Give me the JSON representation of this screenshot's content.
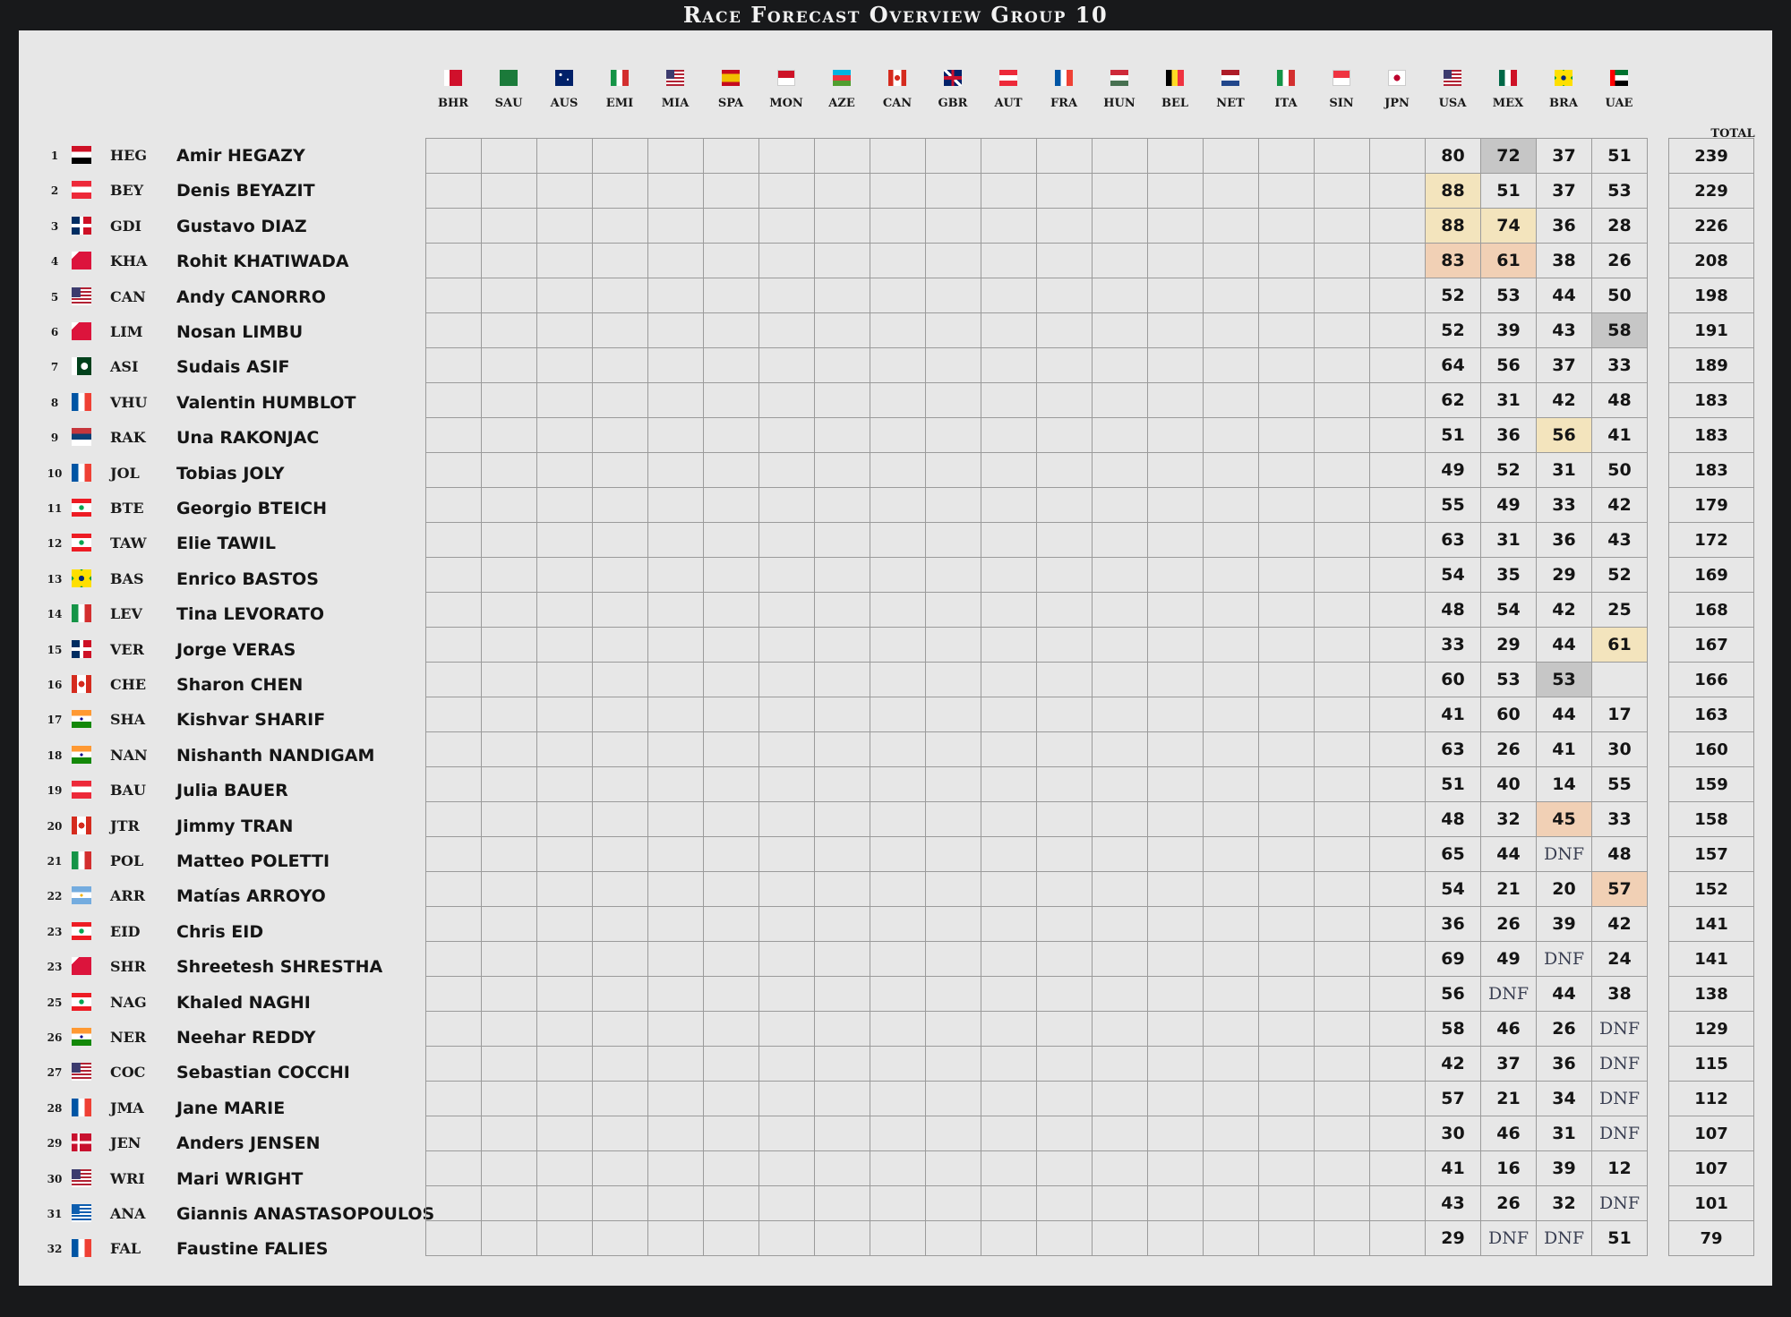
{
  "title": "Race Forecast Overview Group 10",
  "races": [
    {
      "code": "BHR",
      "flag": "bhr"
    },
    {
      "code": "SAU",
      "flag": "sau"
    },
    {
      "code": "AUS",
      "flag": "aus"
    },
    {
      "code": "EMI",
      "flag": "ita"
    },
    {
      "code": "MIA",
      "flag": "usa"
    },
    {
      "code": "SPA",
      "flag": "spa"
    },
    {
      "code": "MON",
      "flag": "mon"
    },
    {
      "code": "AZE",
      "flag": "aze"
    },
    {
      "code": "CAN",
      "flag": "can"
    },
    {
      "code": "GBR",
      "flag": "gbr"
    },
    {
      "code": "AUT",
      "flag": "aut"
    },
    {
      "code": "FRA",
      "flag": "fra"
    },
    {
      "code": "HUN",
      "flag": "hun"
    },
    {
      "code": "BEL",
      "flag": "bel"
    },
    {
      "code": "NET",
      "flag": "net"
    },
    {
      "code": "ITA",
      "flag": "ita"
    },
    {
      "code": "SIN",
      "flag": "sin"
    },
    {
      "code": "JPN",
      "flag": "jpn"
    },
    {
      "code": "USA",
      "flag": "usa"
    },
    {
      "code": "MEX",
      "flag": "mex"
    },
    {
      "code": "BRA",
      "flag": "bra"
    },
    {
      "code": "UAE",
      "flag": "uae"
    }
  ],
  "total_header": "TOTAL",
  "highlight_colors": {
    "gray": "#c6c6c6",
    "yellow": "#f3e4bd",
    "peach": "#f1d0b5"
  },
  "players": [
    {
      "rank": "1",
      "flag": "egy",
      "code": "HEG",
      "name": "Amir HEGAZY",
      "scores": {
        "USA": "80",
        "MEX": "72",
        "BRA": "37",
        "UAE": "51"
      },
      "highlights": {
        "MEX": "gray"
      },
      "total": "239"
    },
    {
      "rank": "2",
      "flag": "aut",
      "code": "BEY",
      "name": "Denis BEYAZIT",
      "scores": {
        "USA": "88",
        "MEX": "51",
        "BRA": "37",
        "UAE": "53"
      },
      "highlights": {
        "USA": "yellow"
      },
      "total": "229"
    },
    {
      "rank": "3",
      "flag": "dom",
      "code": "GDI",
      "name": "Gustavo DIAZ",
      "scores": {
        "USA": "88",
        "MEX": "74",
        "BRA": "36",
        "UAE": "28"
      },
      "highlights": {
        "USA": "yellow",
        "MEX": "yellow"
      },
      "total": "226"
    },
    {
      "rank": "4",
      "flag": "npl",
      "code": "KHA",
      "name": "Rohit KHATIWADA",
      "scores": {
        "USA": "83",
        "MEX": "61",
        "BRA": "38",
        "UAE": "26"
      },
      "highlights": {
        "USA": "peach",
        "MEX": "peach"
      },
      "total": "208"
    },
    {
      "rank": "5",
      "flag": "usa",
      "code": "CAN",
      "name": "Andy CANORRO",
      "scores": {
        "USA": "52",
        "MEX": "53",
        "BRA": "44",
        "UAE": "50"
      },
      "highlights": {},
      "total": "198"
    },
    {
      "rank": "6",
      "flag": "npl",
      "code": "LIM",
      "name": "Nosan LIMBU",
      "scores": {
        "USA": "52",
        "MEX": "39",
        "BRA": "43",
        "UAE": "58"
      },
      "highlights": {
        "UAE": "gray"
      },
      "total": "191"
    },
    {
      "rank": "7",
      "flag": "pak",
      "code": "ASI",
      "name": "Sudais ASIF",
      "scores": {
        "USA": "64",
        "MEX": "56",
        "BRA": "37",
        "UAE": "33"
      },
      "highlights": {},
      "total": "189"
    },
    {
      "rank": "8",
      "flag": "fra",
      "code": "VHU",
      "name": "Valentin HUMBLOT",
      "scores": {
        "USA": "62",
        "MEX": "31",
        "BRA": "42",
        "UAE": "48"
      },
      "highlights": {},
      "total": "183"
    },
    {
      "rank": "9",
      "flag": "srb",
      "code": "RAK",
      "name": "Una RAKONJAC",
      "scores": {
        "USA": "51",
        "MEX": "36",
        "BRA": "56",
        "UAE": "41"
      },
      "highlights": {
        "BRA": "yellow"
      },
      "total": "183"
    },
    {
      "rank": "10",
      "flag": "fra",
      "code": "JOL",
      "name": "Tobias JOLY",
      "scores": {
        "USA": "49",
        "MEX": "52",
        "BRA": "31",
        "UAE": "50"
      },
      "highlights": {},
      "total": "183"
    },
    {
      "rank": "11",
      "flag": "lbn",
      "code": "BTE",
      "name": "Georgio BTEICH",
      "scores": {
        "USA": "55",
        "MEX": "49",
        "BRA": "33",
        "UAE": "42"
      },
      "highlights": {},
      "total": "179"
    },
    {
      "rank": "12",
      "flag": "lbn",
      "code": "TAW",
      "name": "Elie TAWIL",
      "scores": {
        "USA": "63",
        "MEX": "31",
        "BRA": "36",
        "UAE": "43"
      },
      "highlights": {},
      "total": "172"
    },
    {
      "rank": "13",
      "flag": "bra",
      "code": "BAS",
      "name": "Enrico BASTOS",
      "scores": {
        "USA": "54",
        "MEX": "35",
        "BRA": "29",
        "UAE": "52"
      },
      "highlights": {},
      "total": "169"
    },
    {
      "rank": "14",
      "flag": "ita",
      "code": "LEV",
      "name": "Tina LEVORATO",
      "scores": {
        "USA": "48",
        "MEX": "54",
        "BRA": "42",
        "UAE": "25"
      },
      "highlights": {},
      "total": "168"
    },
    {
      "rank": "15",
      "flag": "dom",
      "code": "VER",
      "name": "Jorge VERAS",
      "scores": {
        "USA": "33",
        "MEX": "29",
        "BRA": "44",
        "UAE": "61"
      },
      "highlights": {
        "UAE": "yellow"
      },
      "total": "167"
    },
    {
      "rank": "16",
      "flag": "can",
      "code": "CHE",
      "name": "Sharon CHEN",
      "scores": {
        "USA": "60",
        "MEX": "53",
        "BRA": "53",
        "UAE": ""
      },
      "highlights": {
        "BRA": "gray"
      },
      "total": "166"
    },
    {
      "rank": "17",
      "flag": "ind",
      "code": "SHA",
      "name": "Kishvar SHARIF",
      "scores": {
        "USA": "41",
        "MEX": "60",
        "BRA": "44",
        "UAE": "17"
      },
      "highlights": {},
      "total": "163"
    },
    {
      "rank": "18",
      "flag": "ind",
      "code": "NAN",
      "name": "Nishanth NANDIGAM",
      "scores": {
        "USA": "63",
        "MEX": "26",
        "BRA": "41",
        "UAE": "30"
      },
      "highlights": {},
      "total": "160"
    },
    {
      "rank": "19",
      "flag": "aut",
      "code": "BAU",
      "name": "Julia BAUER",
      "scores": {
        "USA": "51",
        "MEX": "40",
        "BRA": "14",
        "UAE": "55"
      },
      "highlights": {},
      "total": "159"
    },
    {
      "rank": "20",
      "flag": "can",
      "code": "JTR",
      "name": "Jimmy TRAN",
      "scores": {
        "USA": "48",
        "MEX": "32",
        "BRA": "45",
        "UAE": "33"
      },
      "highlights": {
        "BRA": "peach"
      },
      "total": "158"
    },
    {
      "rank": "21",
      "flag": "ita",
      "code": "POL",
      "name": "Matteo POLETTI",
      "scores": {
        "USA": "65",
        "MEX": "44",
        "BRA": "DNF",
        "UAE": "48"
      },
      "highlights": {},
      "total": "157"
    },
    {
      "rank": "22",
      "flag": "arg",
      "code": "ARR",
      "name": "Matías ARROYO",
      "scores": {
        "USA": "54",
        "MEX": "21",
        "BRA": "20",
        "UAE": "57"
      },
      "highlights": {
        "UAE": "peach"
      },
      "total": "152"
    },
    {
      "rank": "23",
      "flag": "lbn",
      "code": "EID",
      "name": "Chris EID",
      "scores": {
        "USA": "36",
        "MEX": "26",
        "BRA": "39",
        "UAE": "42"
      },
      "highlights": {},
      "total": "141"
    },
    {
      "rank": "23",
      "flag": "npl",
      "code": "SHR",
      "name": "Shreetesh SHRESTHA",
      "scores": {
        "USA": "69",
        "MEX": "49",
        "BRA": "DNF",
        "UAE": "24"
      },
      "highlights": {},
      "total": "141"
    },
    {
      "rank": "25",
      "flag": "lbn",
      "code": "NAG",
      "name": "Khaled NAGHI",
      "scores": {
        "USA": "56",
        "MEX": "DNF",
        "BRA": "44",
        "UAE": "38"
      },
      "highlights": {},
      "total": "138"
    },
    {
      "rank": "26",
      "flag": "ind",
      "code": "NER",
      "name": "Neehar REDDY",
      "scores": {
        "USA": "58",
        "MEX": "46",
        "BRA": "26",
        "UAE": "DNF"
      },
      "highlights": {},
      "total": "129"
    },
    {
      "rank": "27",
      "flag": "usa",
      "code": "COC",
      "name": "Sebastian COCCHI",
      "scores": {
        "USA": "42",
        "MEX": "37",
        "BRA": "36",
        "UAE": "DNF"
      },
      "highlights": {},
      "total": "115"
    },
    {
      "rank": "28",
      "flag": "fra",
      "code": "JMA",
      "name": "Jane MARIE",
      "scores": {
        "USA": "57",
        "MEX": "21",
        "BRA": "34",
        "UAE": "DNF"
      },
      "highlights": {},
      "total": "112"
    },
    {
      "rank": "29",
      "flag": "dnk",
      "code": "JEN",
      "name": "Anders JENSEN",
      "scores": {
        "USA": "30",
        "MEX": "46",
        "BRA": "31",
        "UAE": "DNF"
      },
      "highlights": {},
      "total": "107"
    },
    {
      "rank": "30",
      "flag": "usa",
      "code": "WRI",
      "name": "Mari WRIGHT",
      "scores": {
        "USA": "41",
        "MEX": "16",
        "BRA": "39",
        "UAE": "12"
      },
      "highlights": {},
      "total": "107"
    },
    {
      "rank": "31",
      "flag": "grc",
      "code": "ANA",
      "name": "Giannis ANASTASOPOULOS",
      "scores": {
        "USA": "43",
        "MEX": "26",
        "BRA": "32",
        "UAE": "DNF"
      },
      "highlights": {},
      "total": "101"
    },
    {
      "rank": "32",
      "flag": "fra",
      "code": "FAL",
      "name": "Faustine FALIES",
      "scores": {
        "USA": "29",
        "MEX": "DNF",
        "BRA": "DNF",
        "UAE": "51"
      },
      "highlights": {},
      "total": "79"
    }
  ]
}
